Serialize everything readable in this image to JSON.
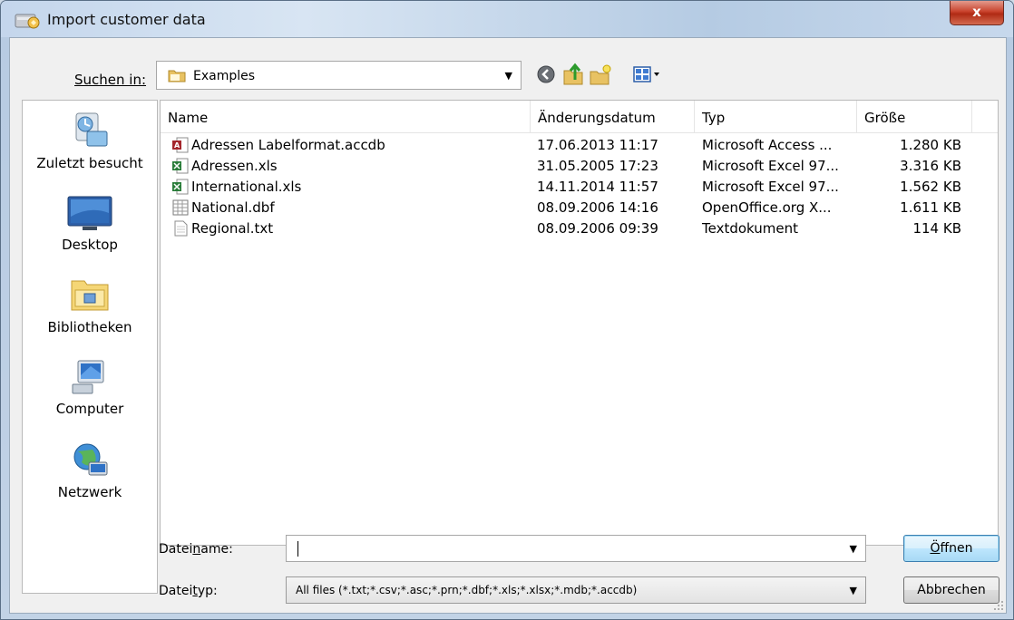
{
  "window": {
    "title": "Import customer data",
    "close_label": "x"
  },
  "toolbar": {
    "look_in_label": "Suchen in:",
    "look_in_value": "Examples",
    "icons": [
      "back-icon",
      "up-folder-icon",
      "new-folder-icon",
      "view-menu-icon"
    ]
  },
  "places": [
    {
      "label": "Zuletzt besucht",
      "icon": "recent-places-icon"
    },
    {
      "label": "Desktop",
      "icon": "desktop-icon"
    },
    {
      "label": "Bibliotheken",
      "icon": "libraries-icon"
    },
    {
      "label": "Computer",
      "icon": "computer-icon"
    },
    {
      "label": "Netzwerk",
      "icon": "network-icon"
    }
  ],
  "columns": {
    "name": "Name",
    "date": "Änderungsdatum",
    "type": "Typ",
    "size": "Größe"
  },
  "files": [
    {
      "name": "Adressen Labelformat.accdb",
      "date": "17.06.2013 11:17",
      "type": "Microsoft Access ...",
      "size": "1.280 KB",
      "icon": "access-file-icon"
    },
    {
      "name": "Adressen.xls",
      "date": "31.05.2005 17:23",
      "type": "Microsoft Excel 97...",
      "size": "3.316 KB",
      "icon": "excel-file-icon"
    },
    {
      "name": "International.xls",
      "date": "14.11.2014 11:57",
      "type": "Microsoft Excel 97...",
      "size": "1.562 KB",
      "icon": "excel-file-icon"
    },
    {
      "name": "National.dbf",
      "date": "08.09.2006 14:16",
      "type": "OpenOffice.org X...",
      "size": "1.611 KB",
      "icon": "dbf-file-icon"
    },
    {
      "name": "Regional.txt",
      "date": "08.09.2006 09:39",
      "type": "Textdokument",
      "size": "114 KB",
      "icon": "text-file-icon"
    }
  ],
  "filename": {
    "label_pre": "Datei",
    "label_accel": "n",
    "label_post": "ame:",
    "value": ""
  },
  "filetype": {
    "label_pre": "Datei",
    "label_accel": "t",
    "label_post": "yp:",
    "value": "All files (*.txt;*.csv;*.asc;*.prn;*.dbf;*.xls;*.xlsx;*.mdb;*.accdb)"
  },
  "buttons": {
    "open_accel": "Ö",
    "open_rest": "ffnen",
    "cancel": "Abbrechen"
  }
}
